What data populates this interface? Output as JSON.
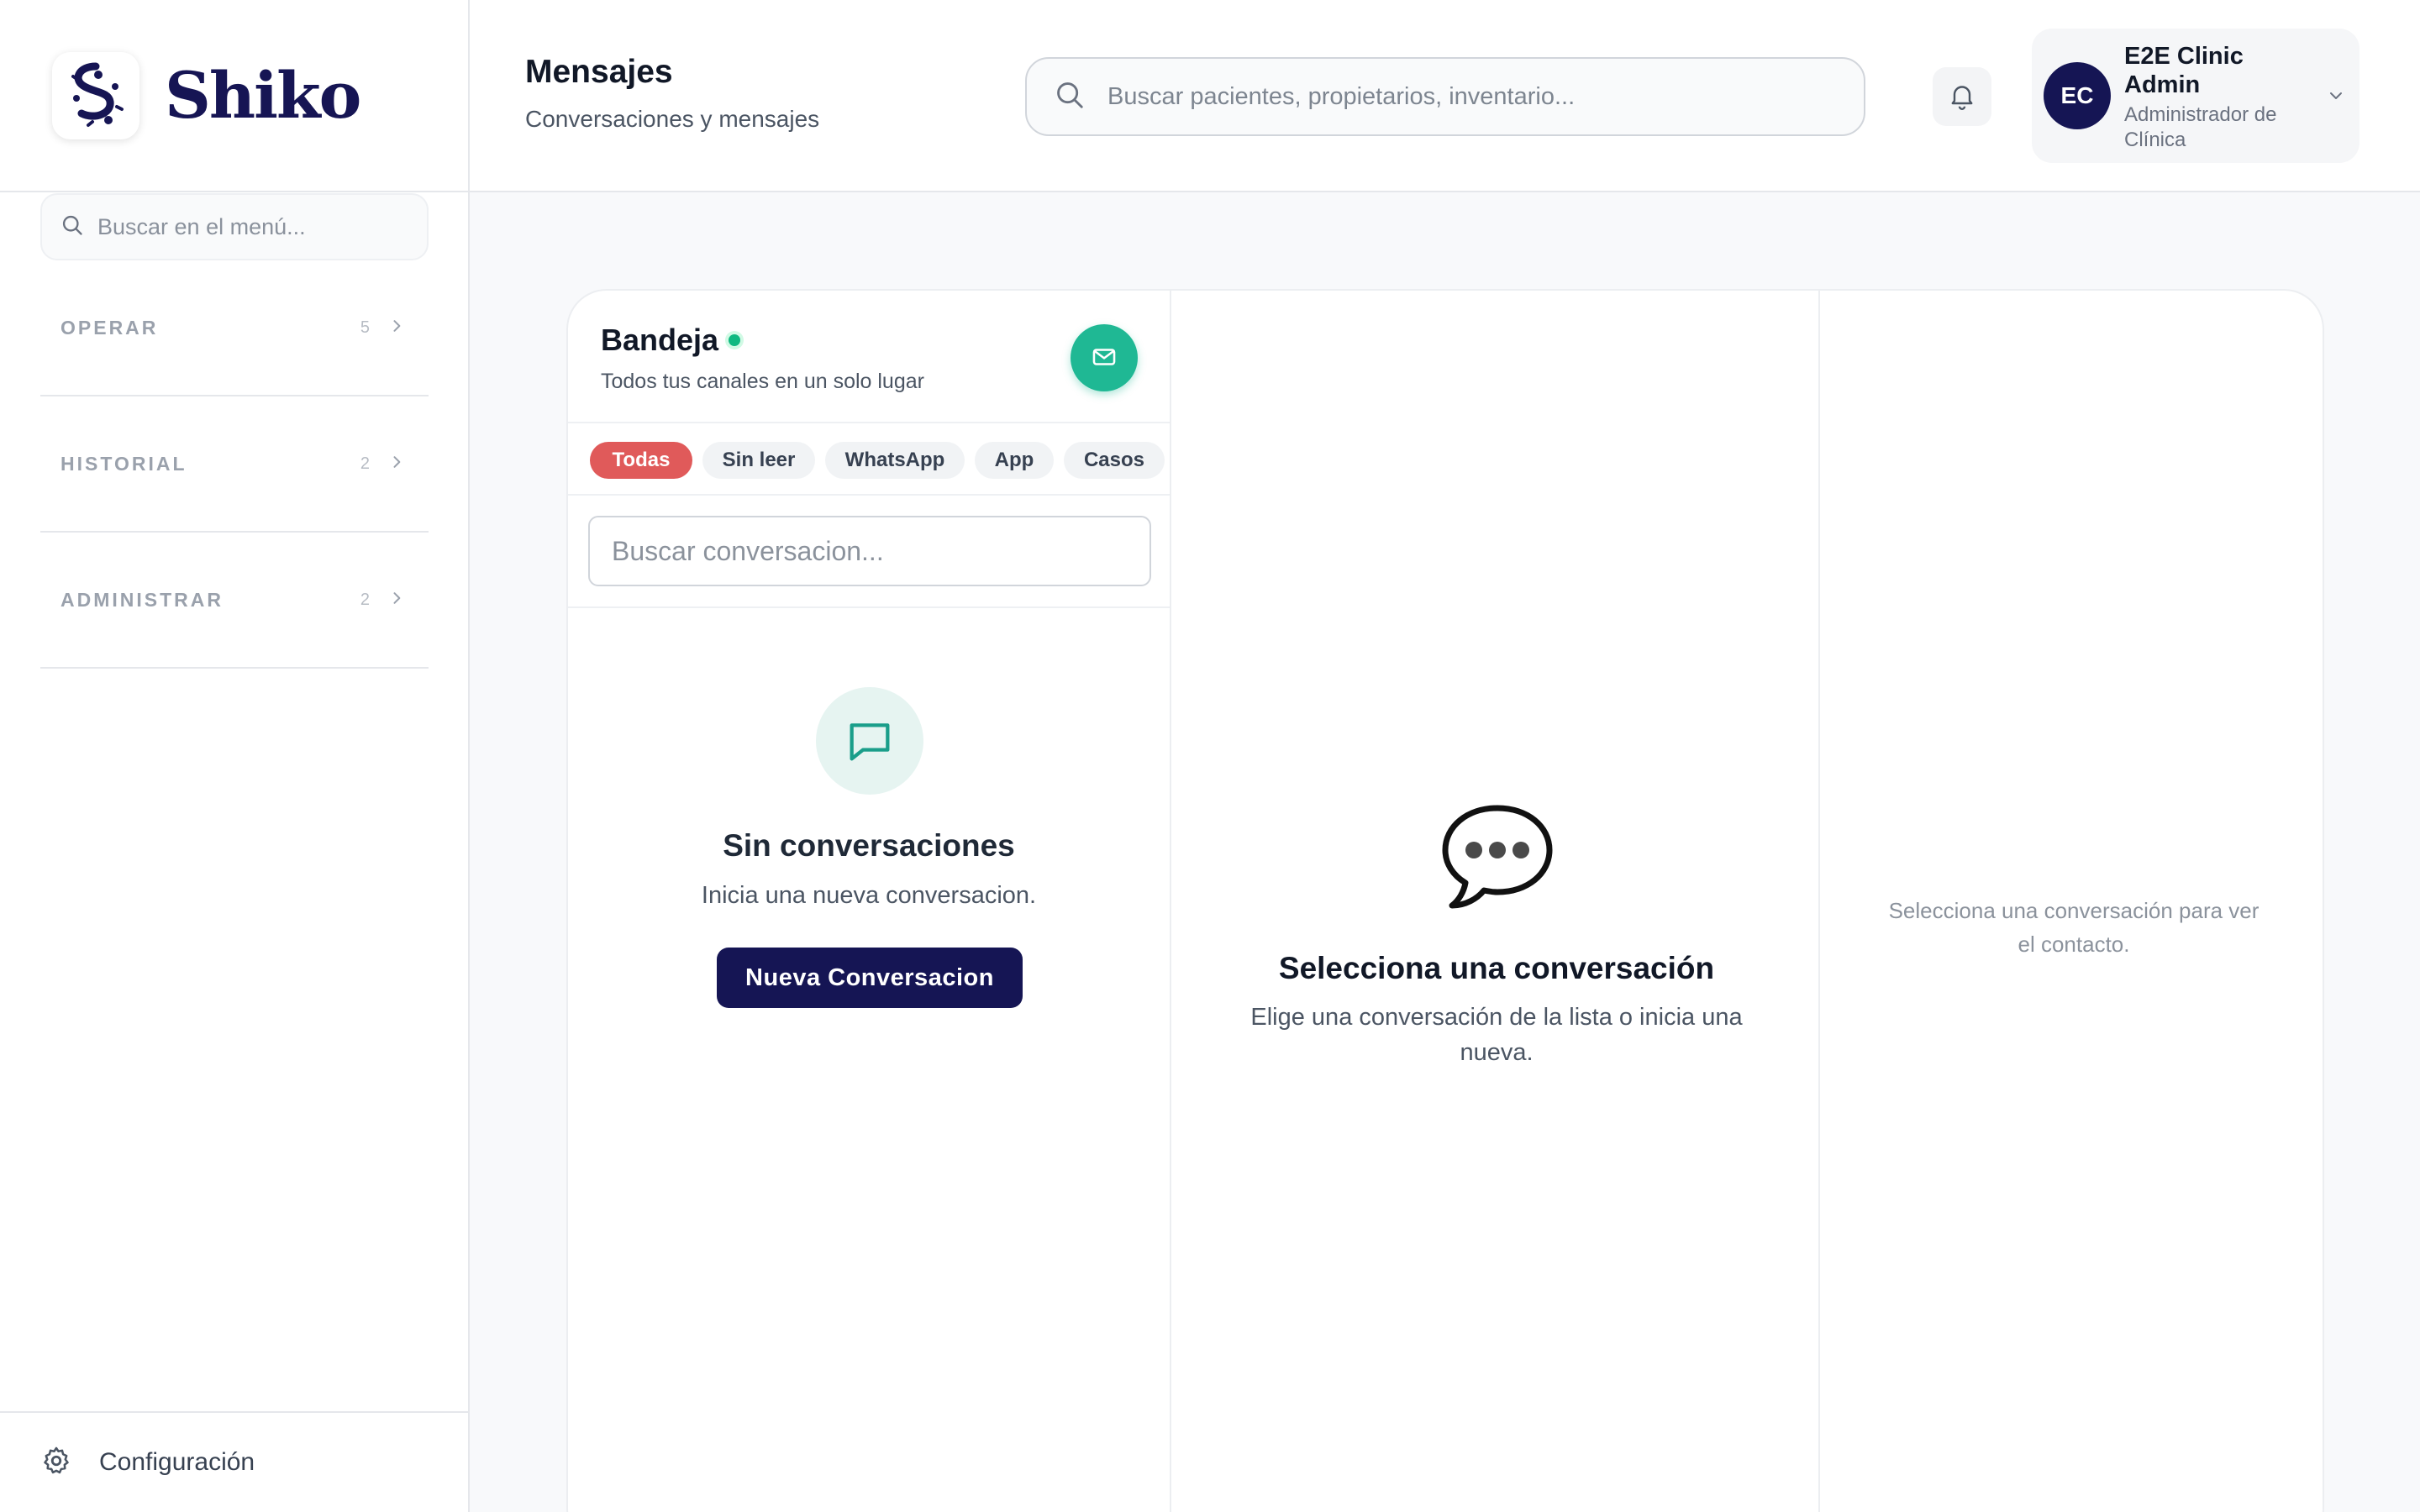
{
  "brand": {
    "name": "Shiko"
  },
  "sidebar": {
    "search_placeholder": "Buscar en el menú...",
    "sections": [
      {
        "label": "OPERAR",
        "count": "5"
      },
      {
        "label": "HISTORIAL",
        "count": "2"
      },
      {
        "label": "ADMINISTRAR",
        "count": "2"
      }
    ],
    "footer": {
      "label": "Configuración"
    }
  },
  "header": {
    "title": "Mensajes",
    "subtitle": "Conversaciones y mensajes",
    "search_placeholder": "Buscar pacientes, propietarios, inventario...",
    "user": {
      "initials": "EC",
      "name": "E2E Clinic Admin",
      "role": "Administrador de Clínica"
    }
  },
  "inbox": {
    "title": "Bandeja",
    "subtitle": "Todos tus canales en un solo lugar",
    "filters": [
      {
        "label": "Todas",
        "active": true
      },
      {
        "label": "Sin leer",
        "active": false
      },
      {
        "label": "WhatsApp",
        "active": false
      },
      {
        "label": "App",
        "active": false
      },
      {
        "label": "Casos",
        "active": false
      }
    ],
    "search_placeholder": "Buscar conversacion...",
    "empty": {
      "title": "Sin conversaciones",
      "text": "Inicia una nueva conversacion.",
      "button": "Nueva Conversacion"
    }
  },
  "thread": {
    "title": "Selecciona una conversación",
    "text": "Elige una conversación de la lista o inicia una nueva."
  },
  "contact": {
    "text": "Selecciona una conversación para ver el contacto."
  },
  "colors": {
    "brand_navy": "#151554",
    "accent_green": "#1fb894",
    "active_filter": "#e05a5a",
    "online": "#10b981"
  }
}
